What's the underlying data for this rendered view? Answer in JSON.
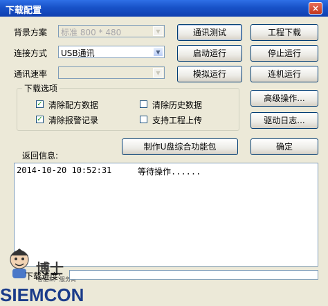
{
  "window": {
    "title": "下载配置",
    "close_symbol": "×"
  },
  "form": {
    "background_scheme": {
      "label": "背景方案",
      "value": "标准 800 * 480",
      "disabled": true
    },
    "connection_mode": {
      "label": "连接方式",
      "value": "USB通讯",
      "disabled": false
    },
    "baud_rate": {
      "label": "通讯速率",
      "value": "",
      "disabled": true
    }
  },
  "buttons": {
    "comm_test": "通讯测试",
    "project_download": "工程下载",
    "start_run": "启动运行",
    "stop_run": "停止运行",
    "simulate_run": "模拟运行",
    "online_run": "连机运行",
    "advanced": "高级操作...",
    "driver_log": "驱动日志...",
    "make_udisk": "制作U盘综合功能包",
    "confirm": "确定"
  },
  "download_options": {
    "title": "下载选项",
    "items": [
      {
        "label": "清除配方数据",
        "checked": true
      },
      {
        "label": "清除历史数据",
        "checked": false
      },
      {
        "label": "清除报警记录",
        "checked": true
      },
      {
        "label": "支持工程上传",
        "checked": false
      }
    ]
  },
  "output": {
    "label": "返回信息:",
    "lines": [
      {
        "time": "2014-10-20 10:52:31",
        "message": "等待操作......"
      }
    ]
  },
  "progress": {
    "label": "下载进度:",
    "value": 0.0
  },
  "watermark": {
    "cn": "博士",
    "sub": "智能工厂服务商",
    "brand": "SIEMCON"
  },
  "colors": {
    "titlebar": "#1852C8",
    "dialog_bg": "#ECE9D8",
    "brand": "#1B3C8A"
  }
}
